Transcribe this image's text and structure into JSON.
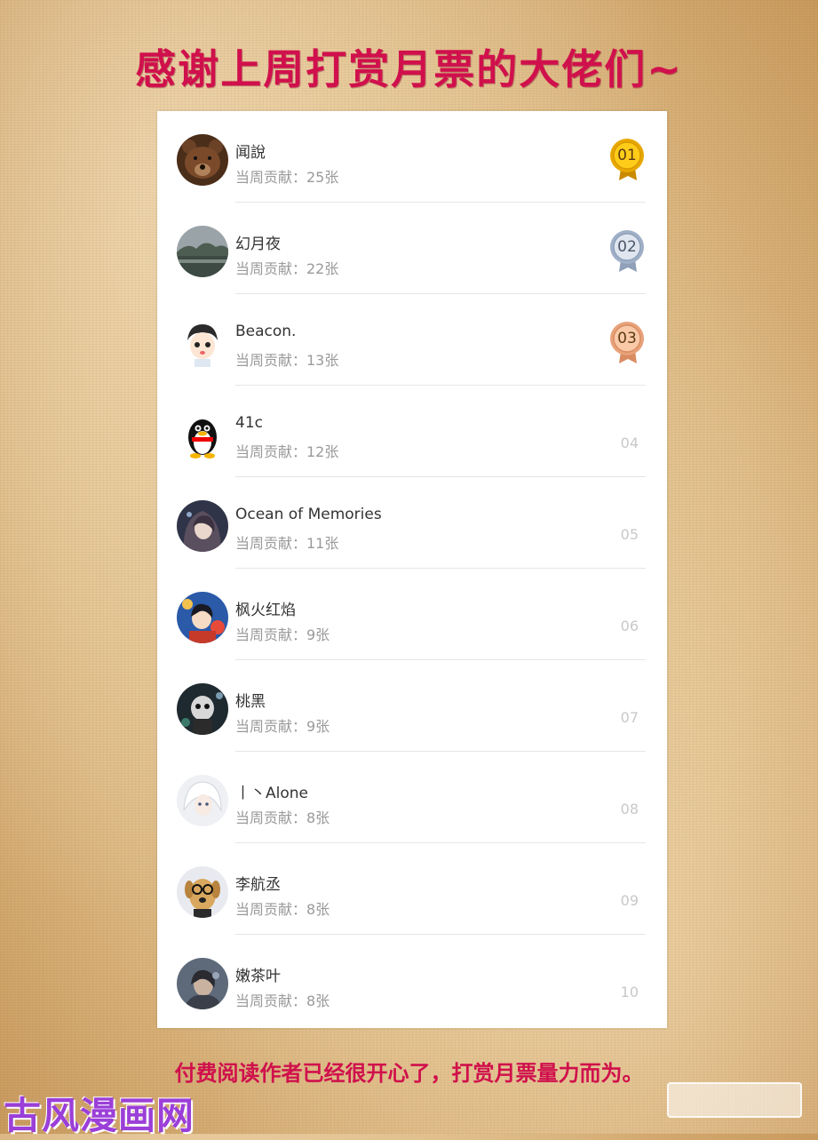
{
  "title": "感谢上周打赏月票的大佬们~",
  "contrib_prefix": "当周贡献：",
  "rows": [
    {
      "name": "闻說",
      "contribution": "当周贡献：25张",
      "rank": "01",
      "medal": "gold",
      "avatar_icon": "bear-avatar-icon"
    },
    {
      "name": "幻月夜",
      "contribution": "当周贡献：22张",
      "rank": "02",
      "medal": "silver",
      "avatar_icon": "landscape-avatar-icon"
    },
    {
      "name": "Beacon.",
      "contribution": "当周贡献：13张",
      "rank": "03",
      "medal": "bronze",
      "avatar_icon": "cartoon-boy-avatar-icon"
    },
    {
      "name": "41c",
      "contribution": "当周贡献：12张",
      "rank": "04",
      "medal": "",
      "avatar_icon": "penguin-avatar-icon"
    },
    {
      "name": "Ocean of Memories",
      "contribution": "当周贡献：11张",
      "rank": "05",
      "medal": "",
      "avatar_icon": "anime-girl-avatar-icon"
    },
    {
      "name": "枫火红焰",
      "contribution": "当周贡献：9张",
      "rank": "06",
      "medal": "",
      "avatar_icon": "anime-boy-avatar-icon"
    },
    {
      "name": "桃黑",
      "contribution": "当周贡献：9张",
      "rank": "07",
      "medal": "",
      "avatar_icon": "dark-character-avatar-icon"
    },
    {
      "name": "丨丶Alone",
      "contribution": "当周贡献：8张",
      "rank": "08",
      "medal": "",
      "avatar_icon": "white-hair-avatar-icon"
    },
    {
      "name": "李航丞",
      "contribution": "当周贡献：8张",
      "rank": "09",
      "medal": "",
      "avatar_icon": "dog-glasses-avatar-icon"
    },
    {
      "name": "嫩茶叶",
      "contribution": "当周贡献：8张",
      "rank": "10",
      "medal": "",
      "avatar_icon": "dark-figure-avatar-icon"
    }
  ],
  "footer": "付费阅读作者已经很开心了，打赏月票量力而为。",
  "watermark_left": "古风漫画网",
  "colors": {
    "title": "#d0104c",
    "gold": "#e8a800",
    "silver": "#9fb0c8",
    "bronze": "#e8a27a",
    "watermark": "#9b3fd8"
  }
}
